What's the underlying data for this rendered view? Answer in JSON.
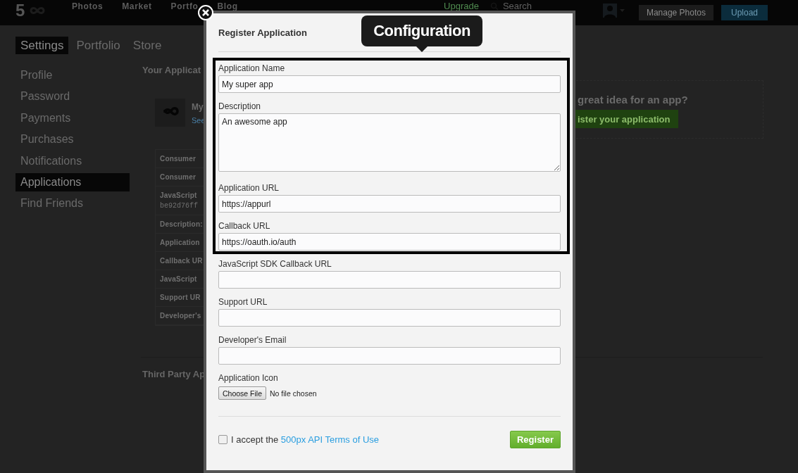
{
  "top_bar": {
    "logo_text": "5",
    "nav": [
      {
        "label": "Photos"
      },
      {
        "label": "Market"
      },
      {
        "label": "Portfo"
      },
      {
        "label": "Blog"
      }
    ],
    "upgrade_link": "Upgrade",
    "search": {
      "placeholder": "Search"
    },
    "buttons": [
      {
        "label": "Manage Photos",
        "kind": "dark"
      },
      {
        "label": "Upload",
        "kind": "primary"
      }
    ]
  },
  "settings_tabs": [
    {
      "label": "Settings",
      "selected": true
    },
    {
      "label": "Portfolio",
      "selected": false
    },
    {
      "label": "Store",
      "selected": false
    }
  ],
  "sidebar": {
    "items": [
      {
        "label": "Profile",
        "selected": false
      },
      {
        "label": "Password",
        "selected": false
      },
      {
        "label": "Payments",
        "selected": false
      },
      {
        "label": "Purchases",
        "selected": false
      },
      {
        "label": "Notifications",
        "selected": false
      },
      {
        "label": "Applications",
        "selected": true
      },
      {
        "label": "Find Friends",
        "selected": false
      }
    ]
  },
  "applications": {
    "heading": "Your Applicat",
    "app": {
      "name": "My",
      "link": "See"
    },
    "details": [
      {
        "label": "Consumer"
      },
      {
        "label": "Consumer"
      },
      {
        "label": "JavaScript",
        "value": "be92d76ff"
      },
      {
        "label": "Description:"
      },
      {
        "label": "Application"
      },
      {
        "label": "Callback UR"
      },
      {
        "label": "JavaScript"
      },
      {
        "label": "Support UR"
      },
      {
        "label": "Developer's"
      }
    ],
    "promo": {
      "text": "great idea for an app?",
      "button": "ister your application"
    }
  },
  "third_party": {
    "heading": "Third Party Ap"
  },
  "modal": {
    "title": "Register Application",
    "tooltip": "Configuration",
    "sections": [
      {
        "highlighted": true,
        "fields": [
          {
            "kind": "text",
            "label": "Application Name",
            "value": "My super app"
          },
          {
            "kind": "textarea",
            "label": "Description",
            "value": "An awesome app"
          },
          {
            "kind": "text",
            "label": "Application URL",
            "value": "https://appurl"
          },
          {
            "kind": "text",
            "label": "Callback URL",
            "value": "https://oauth.io/auth"
          }
        ]
      },
      {
        "highlighted": false,
        "fields": [
          {
            "kind": "text",
            "label": "JavaScript SDK Callback URL"
          },
          {
            "kind": "text",
            "label": "Support URL"
          },
          {
            "kind": "text",
            "label": "Developer's Email"
          },
          {
            "kind": "file",
            "label": "Application Icon",
            "button": "Choose File",
            "status": "No file chosen"
          }
        ]
      }
    ],
    "terms": {
      "checked": false,
      "text": "I accept the",
      "link": "500px API Terms of Use"
    },
    "submit": "Register"
  }
}
